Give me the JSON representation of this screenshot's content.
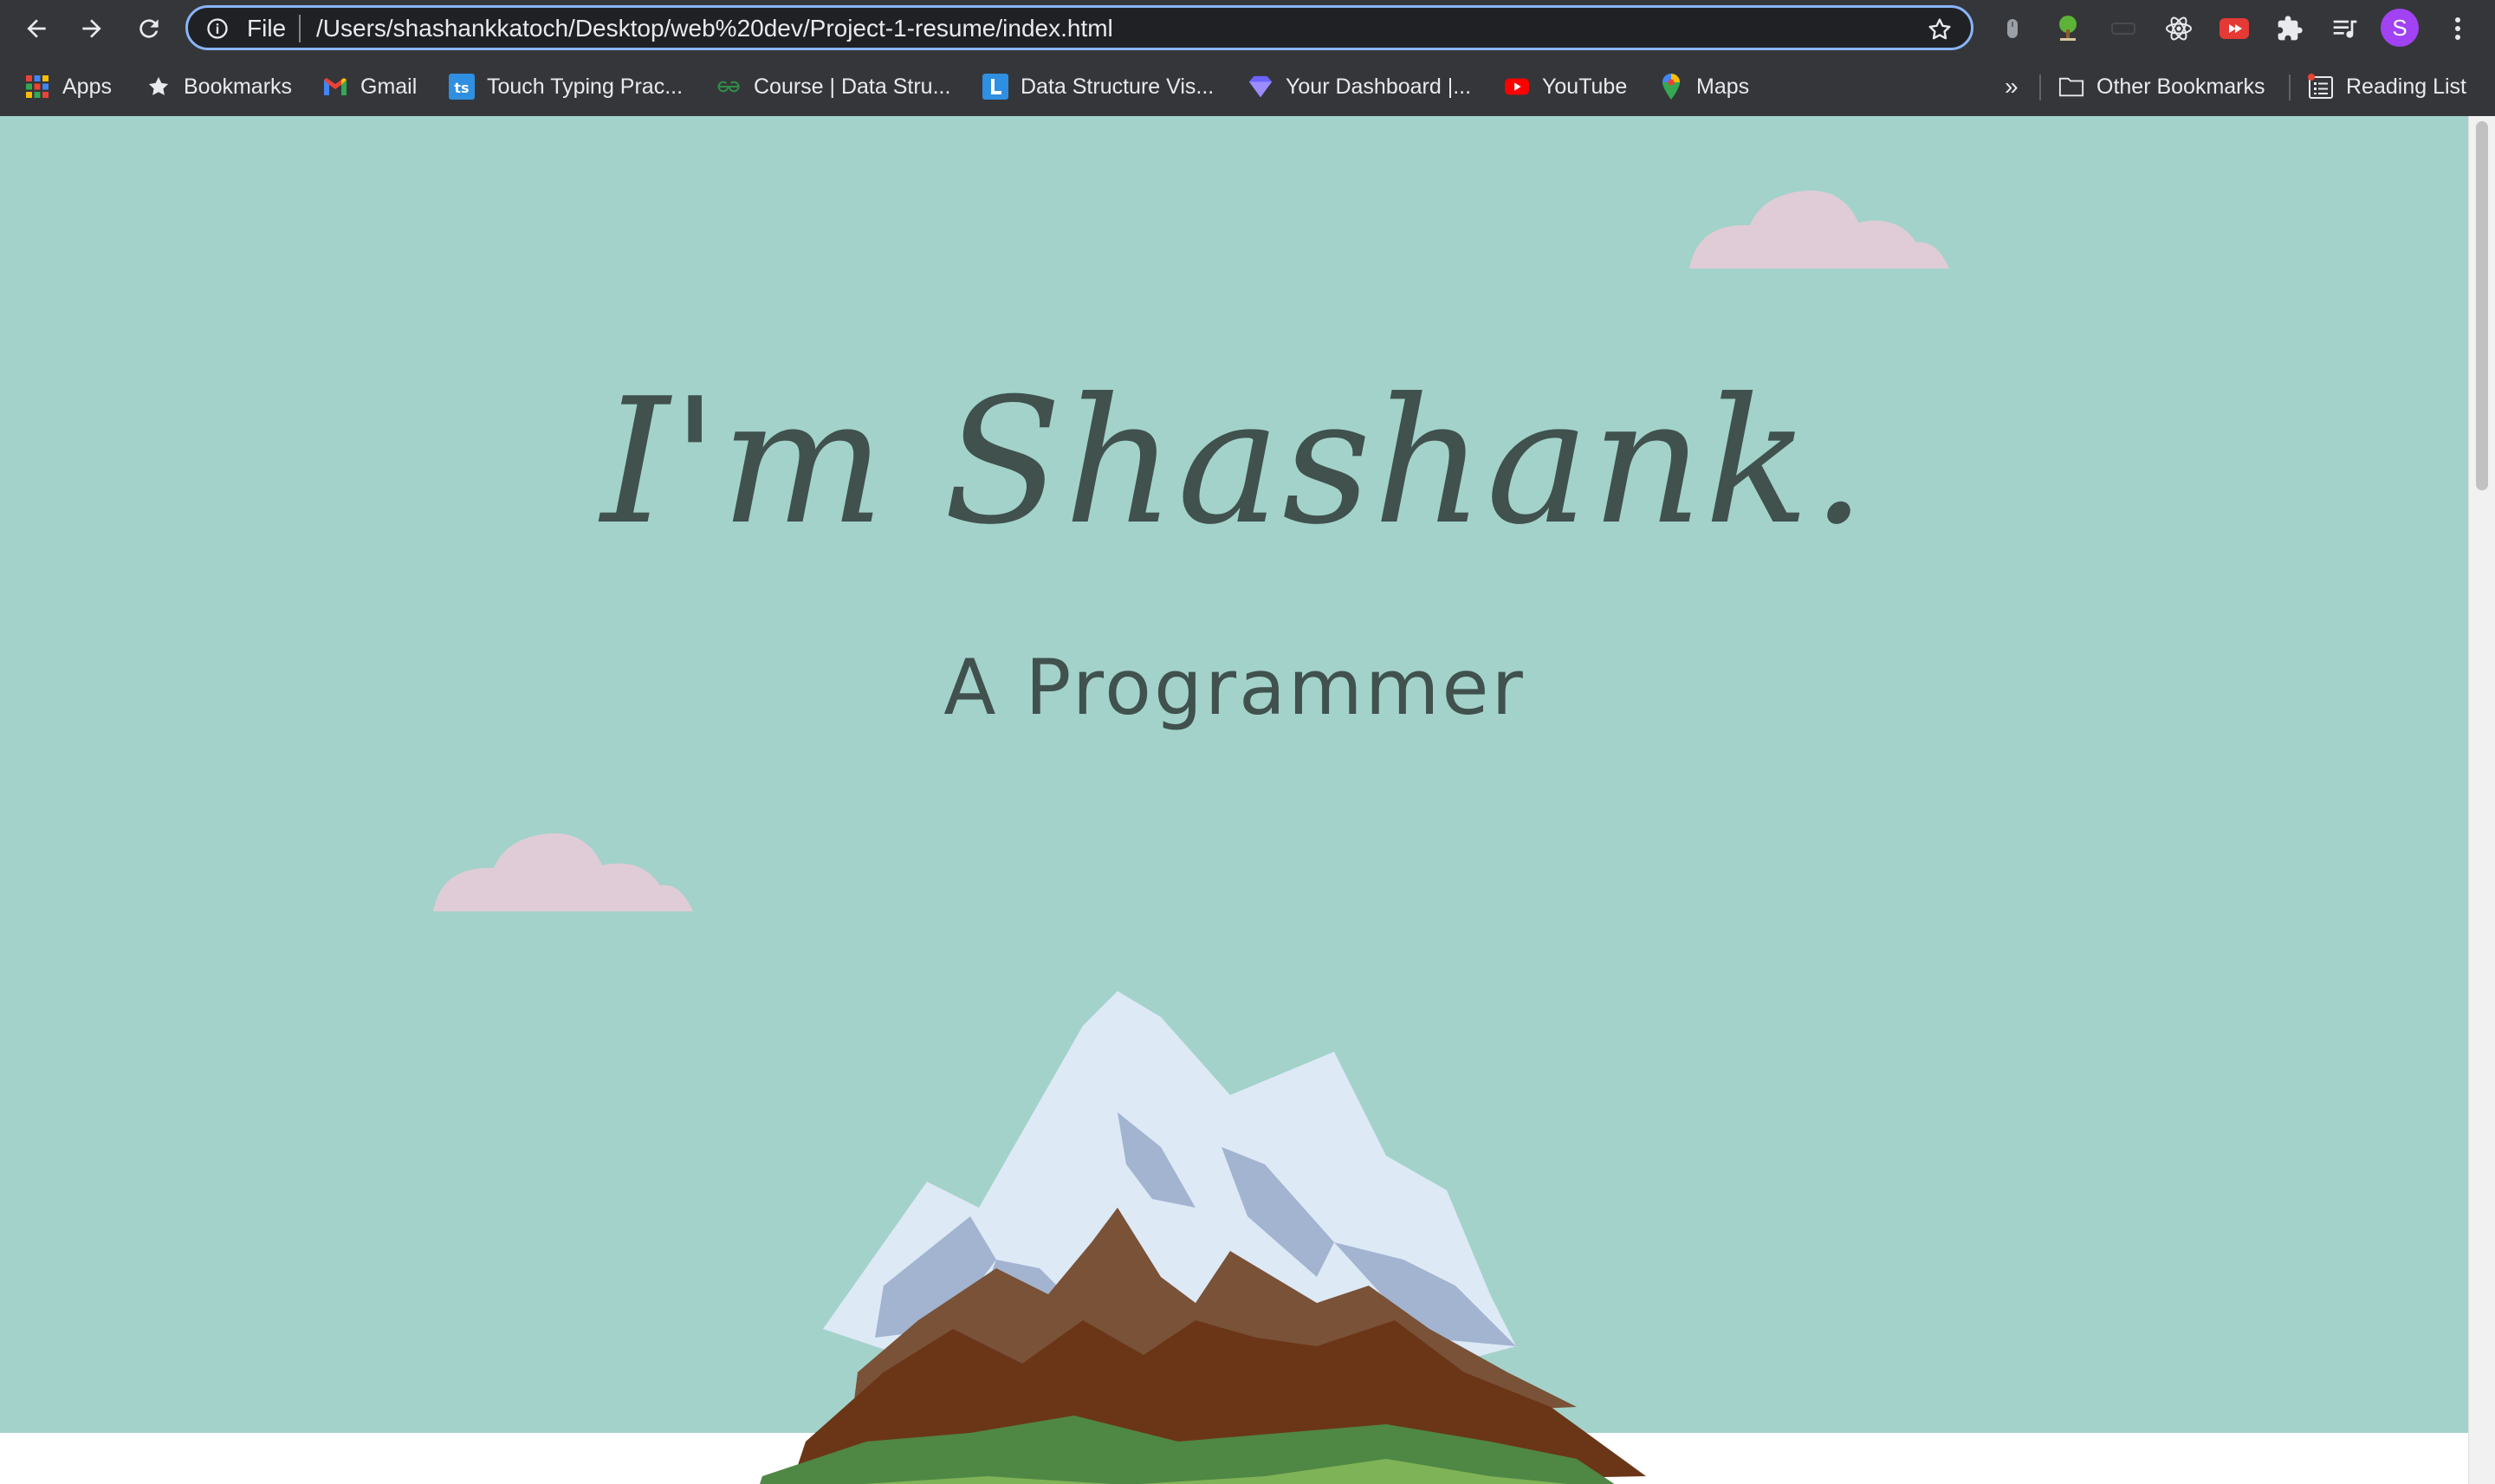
{
  "browser": {
    "omnibox": {
      "scheme": "File",
      "url": "/Users/shashankkatoch/Desktop/web%20dev/Project-1-resume/index.html"
    },
    "profile_initial": "S",
    "bookmarks": [
      {
        "label": "Apps",
        "icon": "apps-grid-icon"
      },
      {
        "label": "Bookmarks",
        "icon": "star-icon"
      },
      {
        "label": "Gmail",
        "icon": "gmail-icon"
      },
      {
        "label": "Touch Typing Prac...",
        "icon": "ts-icon"
      },
      {
        "label": "Course | Data Stru...",
        "icon": "gfg-icon"
      },
      {
        "label": "Data Structure Vis...",
        "icon": "l-icon"
      },
      {
        "label": "Your Dashboard |...",
        "icon": "diamond-icon"
      },
      {
        "label": "YouTube",
        "icon": "youtube-icon"
      },
      {
        "label": "Maps",
        "icon": "maps-pin-icon"
      }
    ],
    "overflow_label": "»",
    "other_bookmarks": "Other Bookmarks",
    "reading_list": "Reading List"
  },
  "page": {
    "title": "I'm Shashank.",
    "subtitle": "A Programmer"
  },
  "colors": {
    "hero_bg": "#a3d2ca",
    "text": "#40514e",
    "cloud": "#e0ccd6",
    "chrome": "#35363a"
  }
}
